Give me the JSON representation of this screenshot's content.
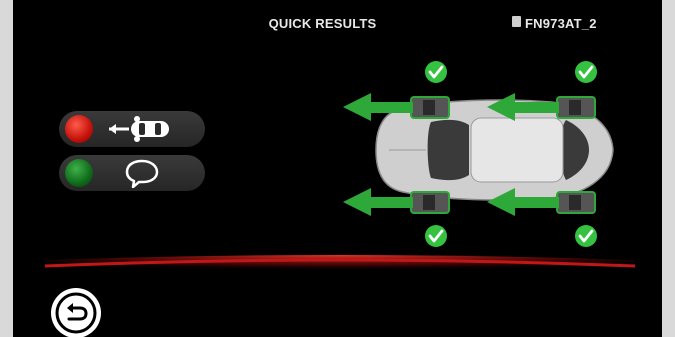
{
  "header": {
    "title": "QUICK RESULTS",
    "device_id": "FN973AT_2"
  },
  "status_indicators": [
    {
      "id": "vehicle-comm",
      "status_color": "#d31a10",
      "icon": "arrow-to-car-icon"
    },
    {
      "id": "sensor-comm",
      "status_color": "#0f7a1e",
      "icon": "speech-bubble-icon"
    }
  ],
  "tires": [
    {
      "position": "front-left",
      "result": "ok",
      "icon": "check-icon"
    },
    {
      "position": "rear-left",
      "result": "ok",
      "icon": "check-icon"
    },
    {
      "position": "front-right",
      "result": "ok",
      "icon": "check-icon"
    },
    {
      "position": "rear-right",
      "result": "ok",
      "icon": "check-icon"
    }
  ],
  "colors": {
    "accent_green": "#2fa83a",
    "check_green": "#34c240",
    "divider_red": "#c01818",
    "background": "#000000"
  },
  "footer": {
    "back_icon": "back-arrow-icon"
  }
}
